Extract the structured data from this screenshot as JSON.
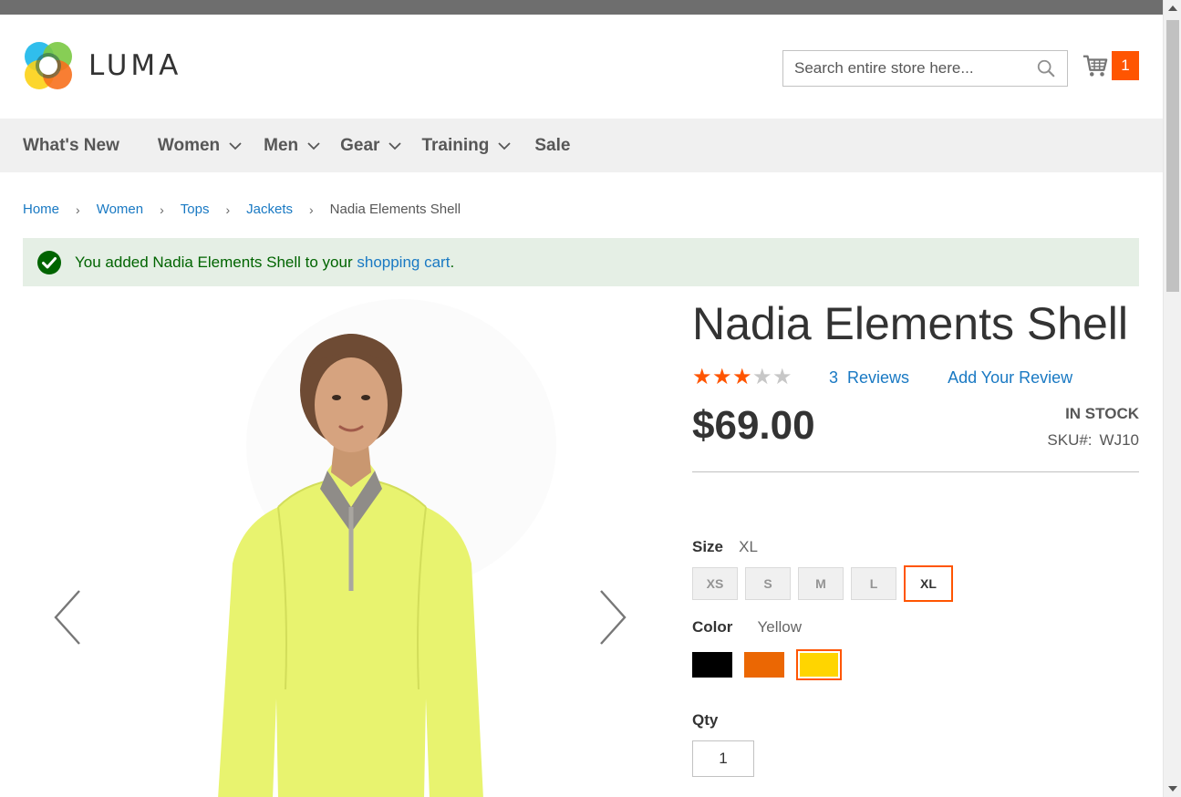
{
  "header": {
    "logo_text": "LUMA",
    "search": {
      "placeholder": "Search entire store here..."
    },
    "cart": {
      "count": "1"
    }
  },
  "nav": {
    "items": [
      {
        "label": "What's New",
        "has_submenu": false
      },
      {
        "label": "Women",
        "has_submenu": true
      },
      {
        "label": "Men",
        "has_submenu": true
      },
      {
        "label": "Gear",
        "has_submenu": true
      },
      {
        "label": "Training",
        "has_submenu": true
      },
      {
        "label": "Sale",
        "has_submenu": false
      }
    ]
  },
  "breadcrumb": {
    "items": [
      "Home",
      "Women",
      "Tops",
      "Jackets"
    ],
    "current": "Nadia Elements Shell"
  },
  "message": {
    "text_before": "You added Nadia Elements Shell to your ",
    "link": "shopping cart",
    "text_after": "."
  },
  "product": {
    "name": "Nadia Elements Shell",
    "rating": {
      "stars": 3,
      "max": 5
    },
    "reviews_count": "3",
    "reviews_label": "Reviews",
    "add_review": "Add Your Review",
    "price": "$69.00",
    "stock": "In stock",
    "sku_label": "SKU#:",
    "sku": "WJ10",
    "size": {
      "label": "Size",
      "selected": "XL",
      "options": [
        "XS",
        "S",
        "M",
        "L",
        "XL"
      ]
    },
    "color": {
      "label": "Color",
      "selected": "Yellow",
      "options": [
        {
          "name": "Black",
          "hex": "#000000"
        },
        {
          "name": "Orange",
          "hex": "#eb6703"
        },
        {
          "name": "Yellow",
          "hex": "#ffd500"
        }
      ]
    },
    "qty": {
      "label": "Qty",
      "value": "1"
    }
  },
  "colors": {
    "accent": "#ff5501",
    "link": "#1979c3",
    "success_bg": "#e5efe5",
    "success_text": "#006400",
    "nav_bg": "#f0f0f0"
  }
}
